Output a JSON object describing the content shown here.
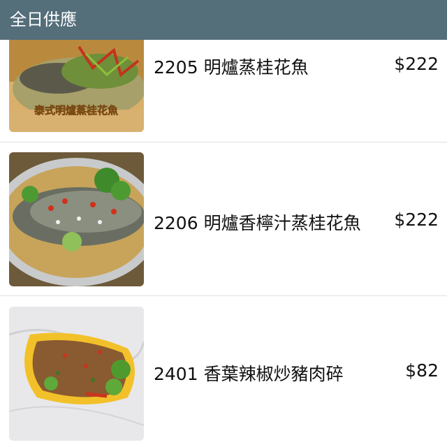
{
  "header": {
    "title": "全日供應"
  },
  "items": [
    {
      "code": "2205",
      "name": "明爐蒸桂花魚",
      "label": "2205 明爐蒸桂花魚",
      "price": "$222",
      "image_caption": "泰式明爐蒸桂花魚"
    },
    {
      "code": "2206",
      "name": "明爐香檸汁蒸桂花魚",
      "label": "2206 明爐香檸汁蒸桂花魚",
      "price": "$222"
    },
    {
      "code": "2401",
      "name": "香葉辣椒炒豬肉碎",
      "label": "2401 香葉辣椒炒豬肉碎",
      "price": "$82"
    }
  ],
  "colors": {
    "header_bg": "#546e7a",
    "header_text": "#ffffff",
    "divider": "#e0e0e0"
  }
}
